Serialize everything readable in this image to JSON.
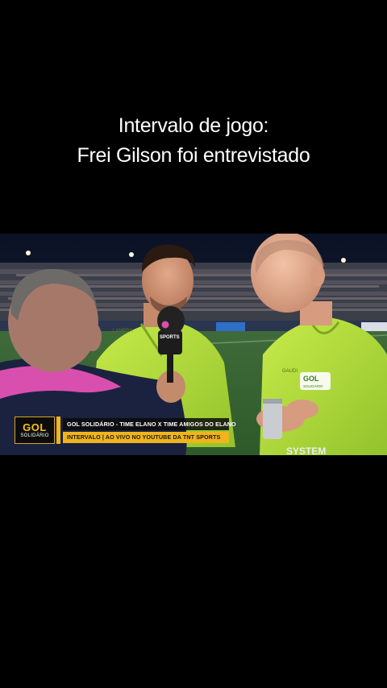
{
  "caption": {
    "line1": "Intervalo de jogo:",
    "line2": "Frei Gilson foi entrevistado"
  },
  "video": {
    "mic_label": "SPORTS",
    "jersey_badge": "GOL",
    "jersey_badge_sub": "SOLIDÁRIO",
    "shirt_sponsor": "SYSTEM"
  },
  "lower_third": {
    "logo_top": "GOL",
    "logo_bottom": "SOLIDÁRIO",
    "headline": "GOL SOLIDÁRIO - TIME ELANO X TIME AMIGOS DO ELANO",
    "subline": "INTERVALO | AO VIVO NO YOUTUBE DA TNT SPORTS"
  },
  "colors": {
    "background": "#000000",
    "jersey_green": "#b7e13c",
    "accent_yellow": "#f0b41c"
  }
}
